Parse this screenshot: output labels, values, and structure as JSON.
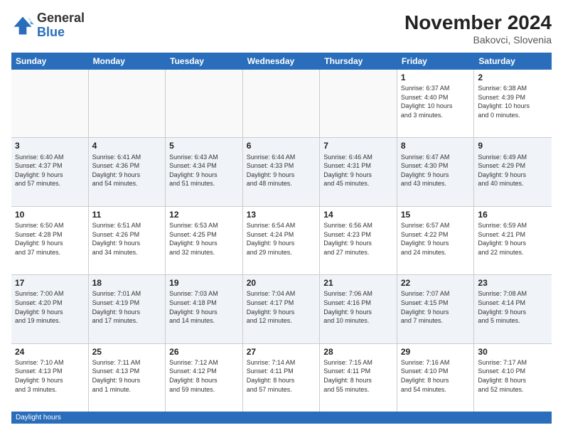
{
  "logo": {
    "general": "General",
    "blue": "Blue"
  },
  "title": "November 2024",
  "location": "Bakovci, Slovenia",
  "footer": "Daylight hours",
  "weekdays": [
    "Sunday",
    "Monday",
    "Tuesday",
    "Wednesday",
    "Thursday",
    "Friday",
    "Saturday"
  ],
  "rows": [
    [
      {
        "day": "",
        "info": ""
      },
      {
        "day": "",
        "info": ""
      },
      {
        "day": "",
        "info": ""
      },
      {
        "day": "",
        "info": ""
      },
      {
        "day": "",
        "info": ""
      },
      {
        "day": "1",
        "info": "Sunrise: 6:37 AM\nSunset: 4:40 PM\nDaylight: 10 hours\nand 3 minutes."
      },
      {
        "day": "2",
        "info": "Sunrise: 6:38 AM\nSunset: 4:39 PM\nDaylight: 10 hours\nand 0 minutes."
      }
    ],
    [
      {
        "day": "3",
        "info": "Sunrise: 6:40 AM\nSunset: 4:37 PM\nDaylight: 9 hours\nand 57 minutes."
      },
      {
        "day": "4",
        "info": "Sunrise: 6:41 AM\nSunset: 4:36 PM\nDaylight: 9 hours\nand 54 minutes."
      },
      {
        "day": "5",
        "info": "Sunrise: 6:43 AM\nSunset: 4:34 PM\nDaylight: 9 hours\nand 51 minutes."
      },
      {
        "day": "6",
        "info": "Sunrise: 6:44 AM\nSunset: 4:33 PM\nDaylight: 9 hours\nand 48 minutes."
      },
      {
        "day": "7",
        "info": "Sunrise: 6:46 AM\nSunset: 4:31 PM\nDaylight: 9 hours\nand 45 minutes."
      },
      {
        "day": "8",
        "info": "Sunrise: 6:47 AM\nSunset: 4:30 PM\nDaylight: 9 hours\nand 43 minutes."
      },
      {
        "day": "9",
        "info": "Sunrise: 6:49 AM\nSunset: 4:29 PM\nDaylight: 9 hours\nand 40 minutes."
      }
    ],
    [
      {
        "day": "10",
        "info": "Sunrise: 6:50 AM\nSunset: 4:28 PM\nDaylight: 9 hours\nand 37 minutes."
      },
      {
        "day": "11",
        "info": "Sunrise: 6:51 AM\nSunset: 4:26 PM\nDaylight: 9 hours\nand 34 minutes."
      },
      {
        "day": "12",
        "info": "Sunrise: 6:53 AM\nSunset: 4:25 PM\nDaylight: 9 hours\nand 32 minutes."
      },
      {
        "day": "13",
        "info": "Sunrise: 6:54 AM\nSunset: 4:24 PM\nDaylight: 9 hours\nand 29 minutes."
      },
      {
        "day": "14",
        "info": "Sunrise: 6:56 AM\nSunset: 4:23 PM\nDaylight: 9 hours\nand 27 minutes."
      },
      {
        "day": "15",
        "info": "Sunrise: 6:57 AM\nSunset: 4:22 PM\nDaylight: 9 hours\nand 24 minutes."
      },
      {
        "day": "16",
        "info": "Sunrise: 6:59 AM\nSunset: 4:21 PM\nDaylight: 9 hours\nand 22 minutes."
      }
    ],
    [
      {
        "day": "17",
        "info": "Sunrise: 7:00 AM\nSunset: 4:20 PM\nDaylight: 9 hours\nand 19 minutes."
      },
      {
        "day": "18",
        "info": "Sunrise: 7:01 AM\nSunset: 4:19 PM\nDaylight: 9 hours\nand 17 minutes."
      },
      {
        "day": "19",
        "info": "Sunrise: 7:03 AM\nSunset: 4:18 PM\nDaylight: 9 hours\nand 14 minutes."
      },
      {
        "day": "20",
        "info": "Sunrise: 7:04 AM\nSunset: 4:17 PM\nDaylight: 9 hours\nand 12 minutes."
      },
      {
        "day": "21",
        "info": "Sunrise: 7:06 AM\nSunset: 4:16 PM\nDaylight: 9 hours\nand 10 minutes."
      },
      {
        "day": "22",
        "info": "Sunrise: 7:07 AM\nSunset: 4:15 PM\nDaylight: 9 hours\nand 7 minutes."
      },
      {
        "day": "23",
        "info": "Sunrise: 7:08 AM\nSunset: 4:14 PM\nDaylight: 9 hours\nand 5 minutes."
      }
    ],
    [
      {
        "day": "24",
        "info": "Sunrise: 7:10 AM\nSunset: 4:13 PM\nDaylight: 9 hours\nand 3 minutes."
      },
      {
        "day": "25",
        "info": "Sunrise: 7:11 AM\nSunset: 4:13 PM\nDaylight: 9 hours\nand 1 minute."
      },
      {
        "day": "26",
        "info": "Sunrise: 7:12 AM\nSunset: 4:12 PM\nDaylight: 8 hours\nand 59 minutes."
      },
      {
        "day": "27",
        "info": "Sunrise: 7:14 AM\nSunset: 4:11 PM\nDaylight: 8 hours\nand 57 minutes."
      },
      {
        "day": "28",
        "info": "Sunrise: 7:15 AM\nSunset: 4:11 PM\nDaylight: 8 hours\nand 55 minutes."
      },
      {
        "day": "29",
        "info": "Sunrise: 7:16 AM\nSunset: 4:10 PM\nDaylight: 8 hours\nand 54 minutes."
      },
      {
        "day": "30",
        "info": "Sunrise: 7:17 AM\nSunset: 4:10 PM\nDaylight: 8 hours\nand 52 minutes."
      }
    ]
  ]
}
